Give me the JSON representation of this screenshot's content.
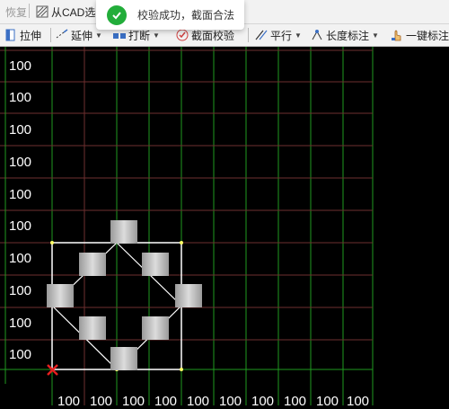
{
  "toolbar_top": {
    "undo_label": "恢复",
    "import_cad_label": "从CAD选"
  },
  "toolbar": {
    "stretch_label": "拉伸",
    "extend_label": "延伸",
    "break_label": "打断",
    "section_check_label": "截面校验",
    "parallel_label": "平行",
    "length_dim_label": "长度标注",
    "one_key_label": "一键标注"
  },
  "toast": {
    "message": "校验成功，截面合法"
  },
  "grid": {
    "y_labels": [
      "100",
      "100",
      "100",
      "100",
      "100",
      "100",
      "100",
      "100",
      "100",
      "100"
    ],
    "x_labels": [
      "100",
      "100",
      "100",
      "100",
      "100",
      "100",
      "100",
      "100",
      "100",
      "100"
    ]
  },
  "colors": {
    "grid_line": "#6e2f2f",
    "axis_green": "#1f9a1f",
    "outline": "#ffffff",
    "origin_marker": "#e81f1f",
    "toast_ok": "#22ad3a"
  }
}
